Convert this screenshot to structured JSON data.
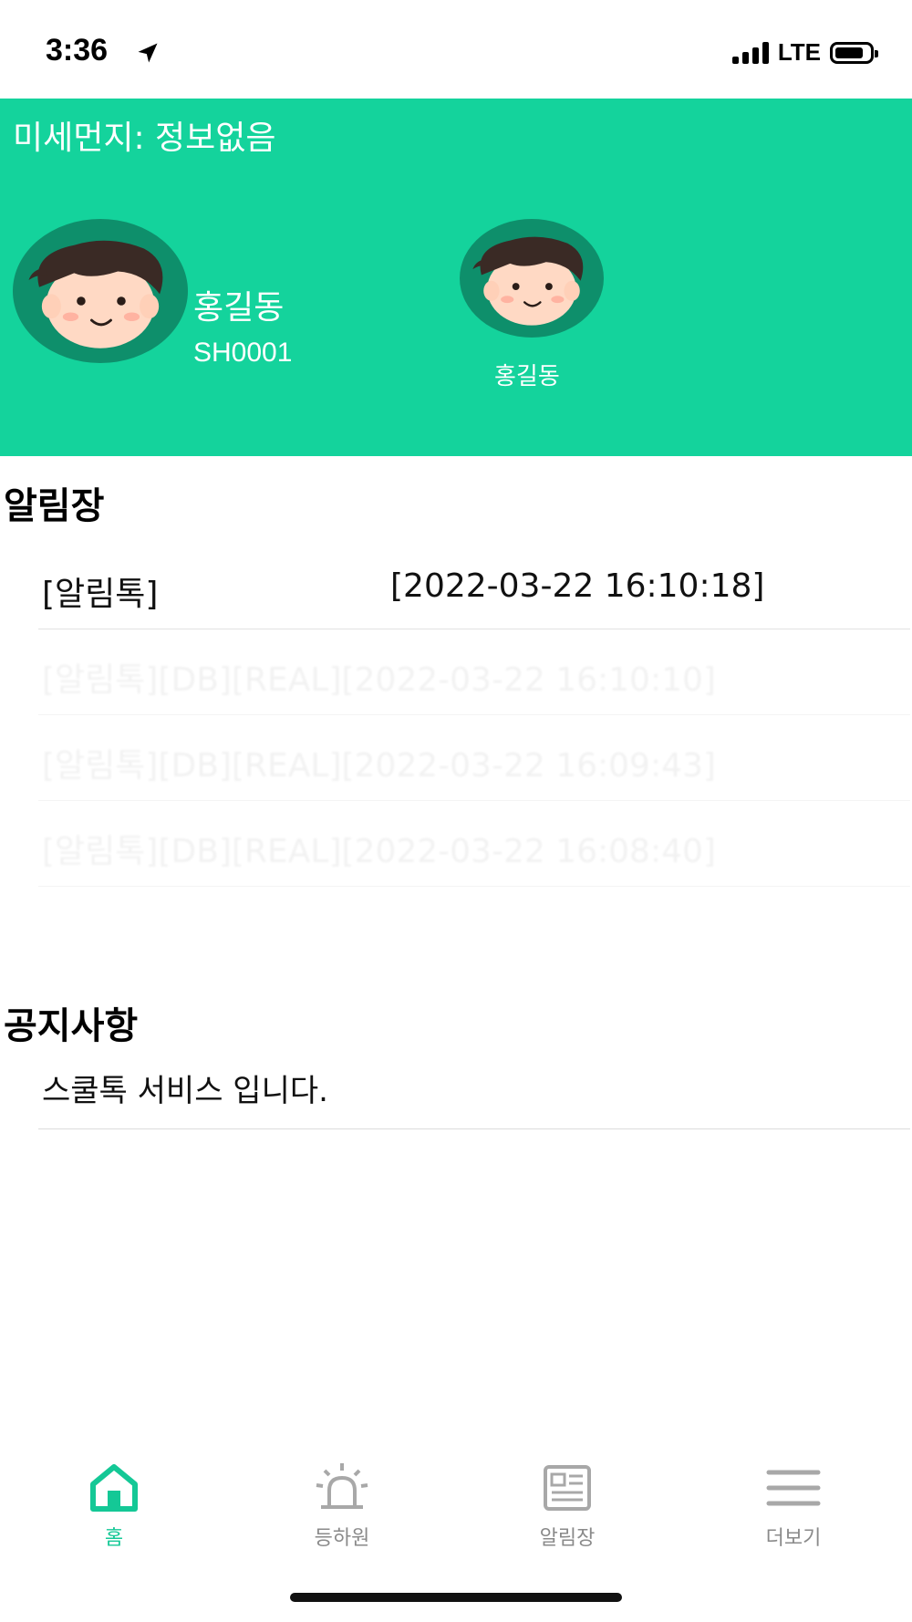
{
  "status_bar": {
    "time": "3:36",
    "network": "LTE"
  },
  "header": {
    "dust_text": "미세먼지: 정보없음",
    "children": [
      {
        "name": "홍길동",
        "id": "SH0001"
      },
      {
        "name": "홍길동"
      }
    ],
    "colors": {
      "header_bg": "#14d39c",
      "avatar_bg": "#0e8f6b"
    }
  },
  "notifications": {
    "title": "알림장",
    "items": [
      {
        "label": "[알림톡]",
        "time": "[2022-03-22 16:10:18]"
      },
      {
        "text": "[알림톡][DB][REAL][2022-03-22 16:10:10]"
      },
      {
        "text": "[알림톡][DB][REAL][2022-03-22 16:09:43]"
      },
      {
        "text": "[알림톡][DB][REAL][2022-03-22 16:08:40]"
      }
    ]
  },
  "notices": {
    "title": "공지사항",
    "items": [
      {
        "text": "스쿨톡 서비스 입니다."
      }
    ]
  },
  "tabbar": {
    "items": [
      {
        "label": "홈",
        "icon": "home-icon",
        "active": true
      },
      {
        "label": "등하원",
        "icon": "siren-icon",
        "active": false
      },
      {
        "label": "알림장",
        "icon": "newspaper-icon",
        "active": false
      },
      {
        "label": "더보기",
        "icon": "menu-icon",
        "active": false
      }
    ],
    "colors": {
      "active": "#14c896",
      "inactive": "#8a8a8a"
    }
  }
}
